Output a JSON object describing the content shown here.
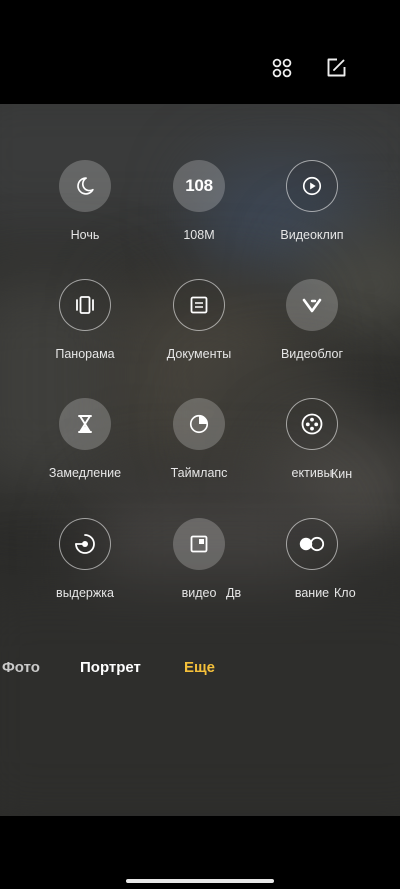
{
  "top_bar": {
    "icons": [
      "grid-icon",
      "edit-icon"
    ]
  },
  "modes": [
    {
      "label": "Ночь",
      "icon": "moon-icon"
    },
    {
      "label": "108M",
      "icon_text": "108"
    },
    {
      "label": "Видеоклип",
      "icon": "play-icon"
    },
    {
      "label": "Панорама",
      "icon": "panorama-icon"
    },
    {
      "label": "Документы",
      "icon": "document-icon"
    },
    {
      "label": "Видеоблог",
      "icon": "vlog-icon"
    },
    {
      "label": "Замедление",
      "icon": "hourglass-icon"
    },
    {
      "label": "Таймлапс",
      "icon": "timelapse-icon"
    },
    {
      "label": "ективы",
      "icon": "film-reel-icon"
    },
    {
      "label": "выдержка",
      "icon": "long-exposure-icon"
    },
    {
      "label": "видео",
      "icon": "dual-video-icon"
    },
    {
      "label": "вание",
      "icon": "clone-icon"
    }
  ],
  "clipped_labels": [
    "Кин",
    "Дв",
    "Кло"
  ],
  "bottom_tabs": [
    {
      "label": "Фото",
      "active": false
    },
    {
      "label": "Портрет",
      "active": false
    },
    {
      "label": "Еще",
      "active": true
    }
  ],
  "colors": {
    "active_tab": "#f5c03a",
    "inactive_tab": "#ffffff"
  }
}
